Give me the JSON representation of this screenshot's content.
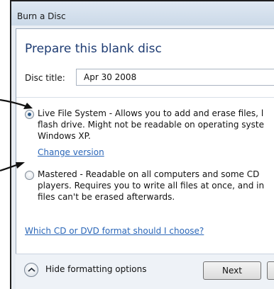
{
  "window": {
    "title": "Burn a Disc"
  },
  "main": {
    "heading": "Prepare this blank disc",
    "disc_title_label": "Disc title:",
    "disc_title_value": "Apr 30 2008"
  },
  "options": {
    "live": {
      "selected": true,
      "lines": [
        "Live File System - Allows you to add and erase files, l",
        "flash drive. Might not be readable on operating syste",
        "Windows XP."
      ],
      "change_version_link": "Change version"
    },
    "mastered": {
      "selected": false,
      "lines": [
        "Mastered - Readable on all computers and some CD",
        "players. Requires you to write all files at once, and in",
        "files can't be erased afterwards."
      ]
    }
  },
  "help_link": "Which CD or DVD format should I choose?",
  "footer": {
    "hide_options_label": "Hide formatting options",
    "next_button": "Next",
    "cancel_button": ""
  },
  "icons": {
    "arrows": [
      "pointer-arrow-icon",
      "pointer-arrow-icon"
    ],
    "collapse": "chevron-up-icon"
  },
  "colors": {
    "heading": "#1e3c73",
    "link": "#2a66b8",
    "radio_selected": "#2c5a8a"
  }
}
